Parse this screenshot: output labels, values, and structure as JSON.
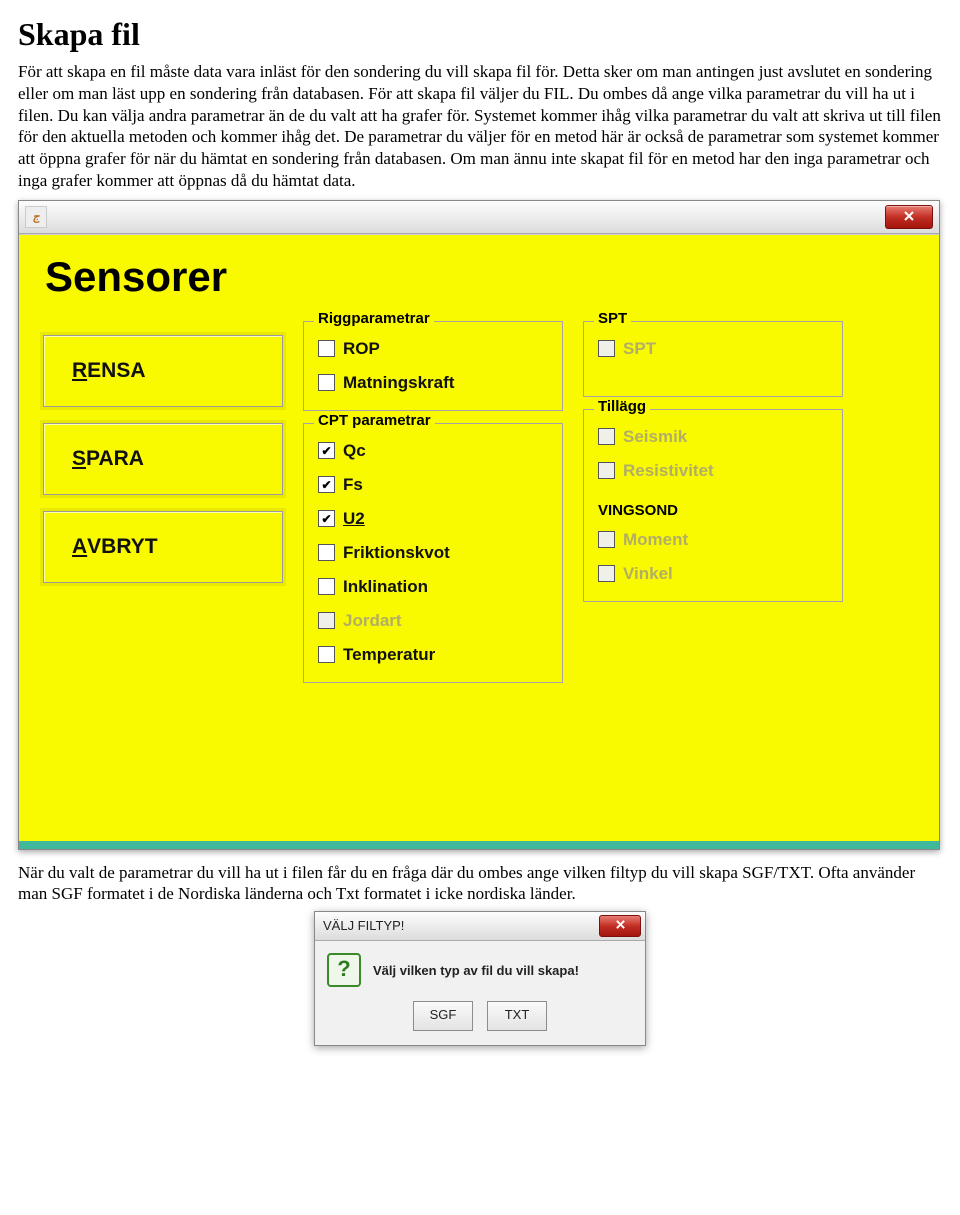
{
  "title": "Skapa fil",
  "paragraph1": "För att skapa en fil måste data vara inläst för den sondering du vill skapa fil för. Detta sker om man antingen just avslutet en sondering eller om man läst upp en sondering från databasen. För att skapa fil väljer du FIL. Du ombes då ange vilka parametrar du vill ha ut i filen. Du kan välja andra parametrar än de du valt att ha grafer för. Systemet kommer ihåg vilka parametrar du valt att skriva ut till filen för den aktuella metoden och kommer ihåg det. De parametrar du väljer för en metod här är också de parametrar som systemet kommer att öppna grafer för när du hämtat en sondering från databasen. Om man ännu inte skapat fil för en metod har den inga parametrar och inga grafer kommer att öppnas då du hämtat data.",
  "paragraph2": "När du valt de parametrar du vill ha ut i filen får du en fråga där du ombes ange vilken filtyp du vill skapa SGF/TXT. Ofta använder man SGF formatet i de Nordiska länderna och Txt formatet i icke nordiska länder.",
  "dialog1": {
    "panel_title": "Sensorer",
    "buttons": {
      "rensa_prefix": "R",
      "rensa_rest": "ENSA",
      "spara_prefix": "S",
      "spara_rest": "PARA",
      "avbryt_prefix": "A",
      "avbryt_rest": "VBRYT"
    },
    "groups": {
      "rigg": {
        "title": "Riggparametrar",
        "items": [
          {
            "label": "ROP",
            "checked": false,
            "soft": false
          },
          {
            "label": "Matningskraft",
            "checked": false,
            "soft": false
          }
        ]
      },
      "cpt": {
        "title": "CPT parametrar",
        "items": [
          {
            "label": "Qc",
            "checked": true,
            "soft": false
          },
          {
            "label": "Fs",
            "checked": true,
            "soft": false
          },
          {
            "label": "U2",
            "checked": true,
            "soft": false,
            "underline": true
          },
          {
            "label": "Friktionskvot",
            "checked": false,
            "soft": false
          },
          {
            "label": "Inklination",
            "checked": false,
            "soft": false
          },
          {
            "label": "Jordart",
            "checked": false,
            "soft": true
          },
          {
            "label": "Temperatur",
            "checked": false,
            "soft": false
          }
        ]
      },
      "spt": {
        "title": "SPT",
        "items": [
          {
            "label": "SPT",
            "checked": false,
            "soft": true
          }
        ]
      },
      "tillagg": {
        "title": "Tillägg",
        "items": [
          {
            "label": "Seismik",
            "checked": false,
            "soft": true
          },
          {
            "label": "Resistivitet",
            "checked": false,
            "soft": true
          }
        ],
        "sub_title": "VINGSOND",
        "sub_items": [
          {
            "label": "Moment",
            "checked": false,
            "soft": true
          },
          {
            "label": "Vinkel",
            "checked": false,
            "soft": true
          }
        ]
      }
    }
  },
  "dialog2": {
    "title": "VÄLJ FILTYP!",
    "message": "Välj vilken typ av fil du vill skapa!",
    "btn1": "SGF",
    "btn2": "TXT"
  }
}
